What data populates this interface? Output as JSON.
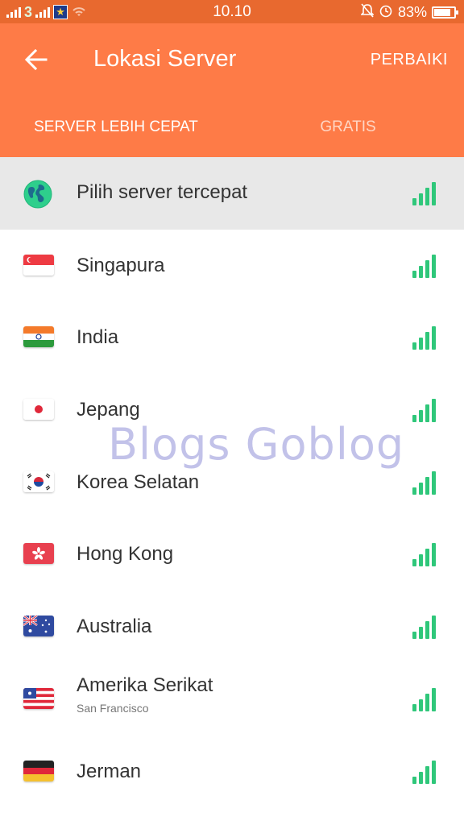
{
  "status_bar": {
    "carrier": "3",
    "time": "10.10",
    "battery": "83%",
    "battery_level": 0.83
  },
  "app_bar": {
    "title": "Lokasi Server",
    "action_label": "PERBAIKI",
    "accent_color": "#fe7b47"
  },
  "tabs": [
    {
      "label": "SERVER LEBIH CEPAT",
      "active": true
    },
    {
      "label": "GRATIS",
      "active": false
    }
  ],
  "servers": [
    {
      "label": "Pilih server tercepat",
      "icon": "globe-icon",
      "selected": true
    },
    {
      "label": "Singapura",
      "icon": "singapore-flag-icon"
    },
    {
      "label": "India",
      "icon": "india-flag-icon"
    },
    {
      "label": "Jepang",
      "icon": "japan-flag-icon"
    },
    {
      "label": "Korea Selatan",
      "icon": "south-korea-flag-icon"
    },
    {
      "label": "Hong Kong",
      "icon": "hong-kong-flag-icon"
    },
    {
      "label": "Australia",
      "icon": "australia-flag-icon"
    },
    {
      "label": "Amerika Serikat",
      "sublabel": "San Francisco",
      "icon": "usa-flag-icon"
    },
    {
      "label": "Jerman",
      "icon": "germany-flag-icon"
    }
  ],
  "signal_color": "#2fc77a",
  "watermark": "Blogs Goblog"
}
